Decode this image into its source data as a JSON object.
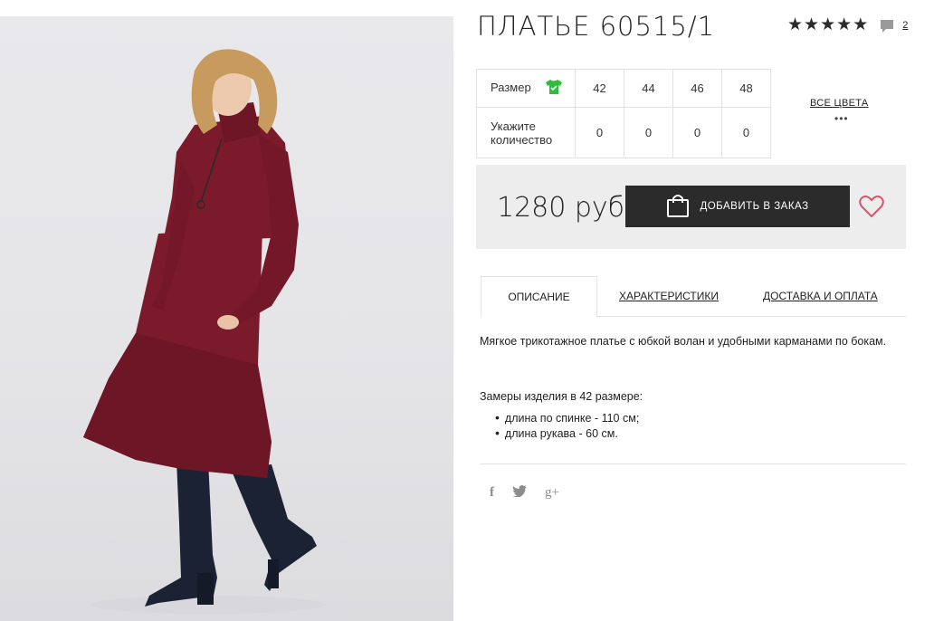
{
  "product": {
    "title": "ПЛАТЬЕ 60515/1",
    "rating_stars": 5,
    "reviews_count": "2"
  },
  "sizes": {
    "size_label": "Размер",
    "qty_label": "Укажите количество",
    "sizes": [
      "42",
      "44",
      "46",
      "48"
    ],
    "quantities": [
      "0",
      "0",
      "0",
      "0"
    ],
    "all_colors": "ВСЕ ЦВЕТА",
    "more": "•••"
  },
  "buy": {
    "price": "1280 руб",
    "add_label": "ДОБАВИТЬ В ЗАКАЗ"
  },
  "tabs": [
    "ОПИСАНИЕ",
    "ХАРАКТЕРИСТИКИ",
    "ДОСТАВКА И ОПЛАТА"
  ],
  "description": {
    "text": "Мягкое трикотажное платье с юбкой волан и удобными карманами по бокам.",
    "measure_title": "Замеры изделия в 42 размере:",
    "measures": [
      "длина по спинке - 110 см;",
      "длина рукава - 60 см."
    ]
  },
  "social": {
    "facebook": "f",
    "twitter": "twitter-icon",
    "google": "g+"
  },
  "colors": {
    "dress": "#7a1a2b",
    "dark": "#2b2b2b",
    "accent_green": "#2bbf3a",
    "heart": "#d9536c"
  }
}
